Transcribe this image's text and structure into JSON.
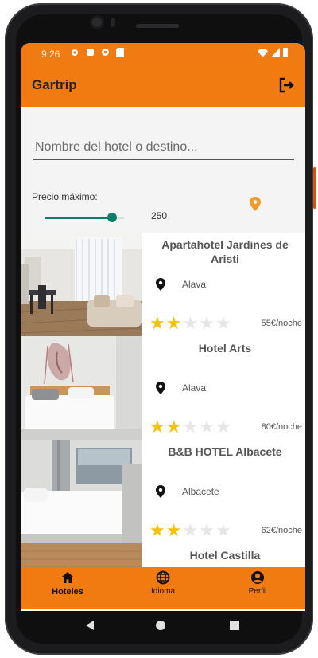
{
  "status": {
    "time": "9:26"
  },
  "appbar": {
    "title": "Gartrip"
  },
  "search": {
    "placeholder": "Nombre del hotel o destino..."
  },
  "filter": {
    "price_label": "Precio máximo:",
    "price_value": "250",
    "slider_fraction": 0.85
  },
  "hotels": [
    {
      "name": "Apartahotel Jardines de Aristi",
      "location": "Alava",
      "rating": 2,
      "max_rating": 5,
      "price": "55€/noche"
    },
    {
      "name": "Hotel Arts",
      "location": "Alava",
      "rating": 2,
      "max_rating": 5,
      "price": "80€/noche"
    },
    {
      "name": "B&B HOTEL Albacete",
      "location": "Albacete",
      "rating": 2,
      "max_rating": 5,
      "price": "62€/noche"
    },
    {
      "name": "Hotel Castilla",
      "location": "",
      "rating": 0,
      "max_rating": 5,
      "price": ""
    }
  ],
  "nav": {
    "items": [
      {
        "label": "Hoteles",
        "icon": "home-icon",
        "active": true
      },
      {
        "label": "Idioma",
        "icon": "globe-icon",
        "active": false
      },
      {
        "label": "Perfil",
        "icon": "user-icon",
        "active": false
      }
    ]
  },
  "colors": {
    "accent": "#f17b10",
    "slider": "#107c6a",
    "star": "#f5c20a"
  }
}
